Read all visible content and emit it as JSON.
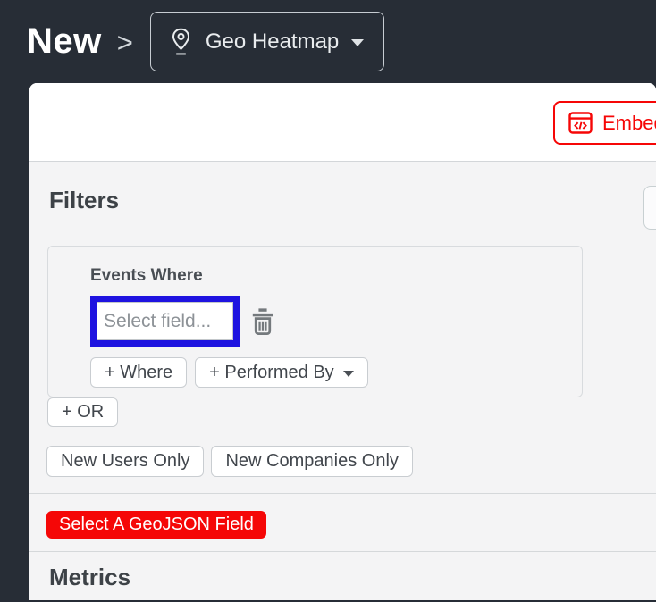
{
  "header": {
    "breadcrumb_root": "New",
    "separator": ">",
    "report_type_label": "Geo Heatmap"
  },
  "toolbar": {
    "embed_label": "Embed"
  },
  "filters": {
    "heading": "Filters",
    "group": {
      "title": "Events Where",
      "select_placeholder": "Select field...",
      "add_where_label": "+ Where",
      "performed_by_label": "+ Performed By"
    },
    "or_label": "+ OR",
    "new_users_label": "New Users Only",
    "new_companies_label": "New Companies Only",
    "geojson_button_label": "Select A GeoJSON Field"
  },
  "metrics": {
    "heading": "Metrics"
  },
  "icons": {
    "location_pin": "location-pin-icon",
    "caret_down": "caret-down-icon",
    "embed_code": "embed-code-icon",
    "trash": "trash-icon"
  },
  "colors": {
    "dark_background": "#272d36",
    "card_background": "#f4f4f5",
    "accent_red": "#f50707",
    "highlight_blue": "#1e13e0"
  }
}
